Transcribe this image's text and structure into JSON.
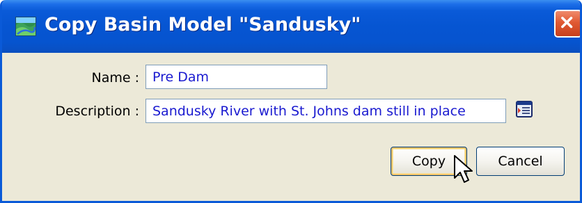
{
  "window": {
    "title": "Copy Basin Model \"Sandusky\"",
    "icon": "basin-model-icon",
    "close_icon": "close-icon"
  },
  "form": {
    "name_label": "Name :",
    "name_value": "Pre Dam",
    "description_label": "Description :",
    "description_value": "Sandusky River with St. Johns dam still in place",
    "description_button_icon": "text-editor-icon"
  },
  "buttons": {
    "copy_label": "Copy",
    "cancel_label": "Cancel"
  },
  "colors": {
    "titlebar": "#0a5ad8",
    "window_bg": "#ece9d8",
    "input_text": "#1a1ad0",
    "close_button": "#e05a33"
  }
}
